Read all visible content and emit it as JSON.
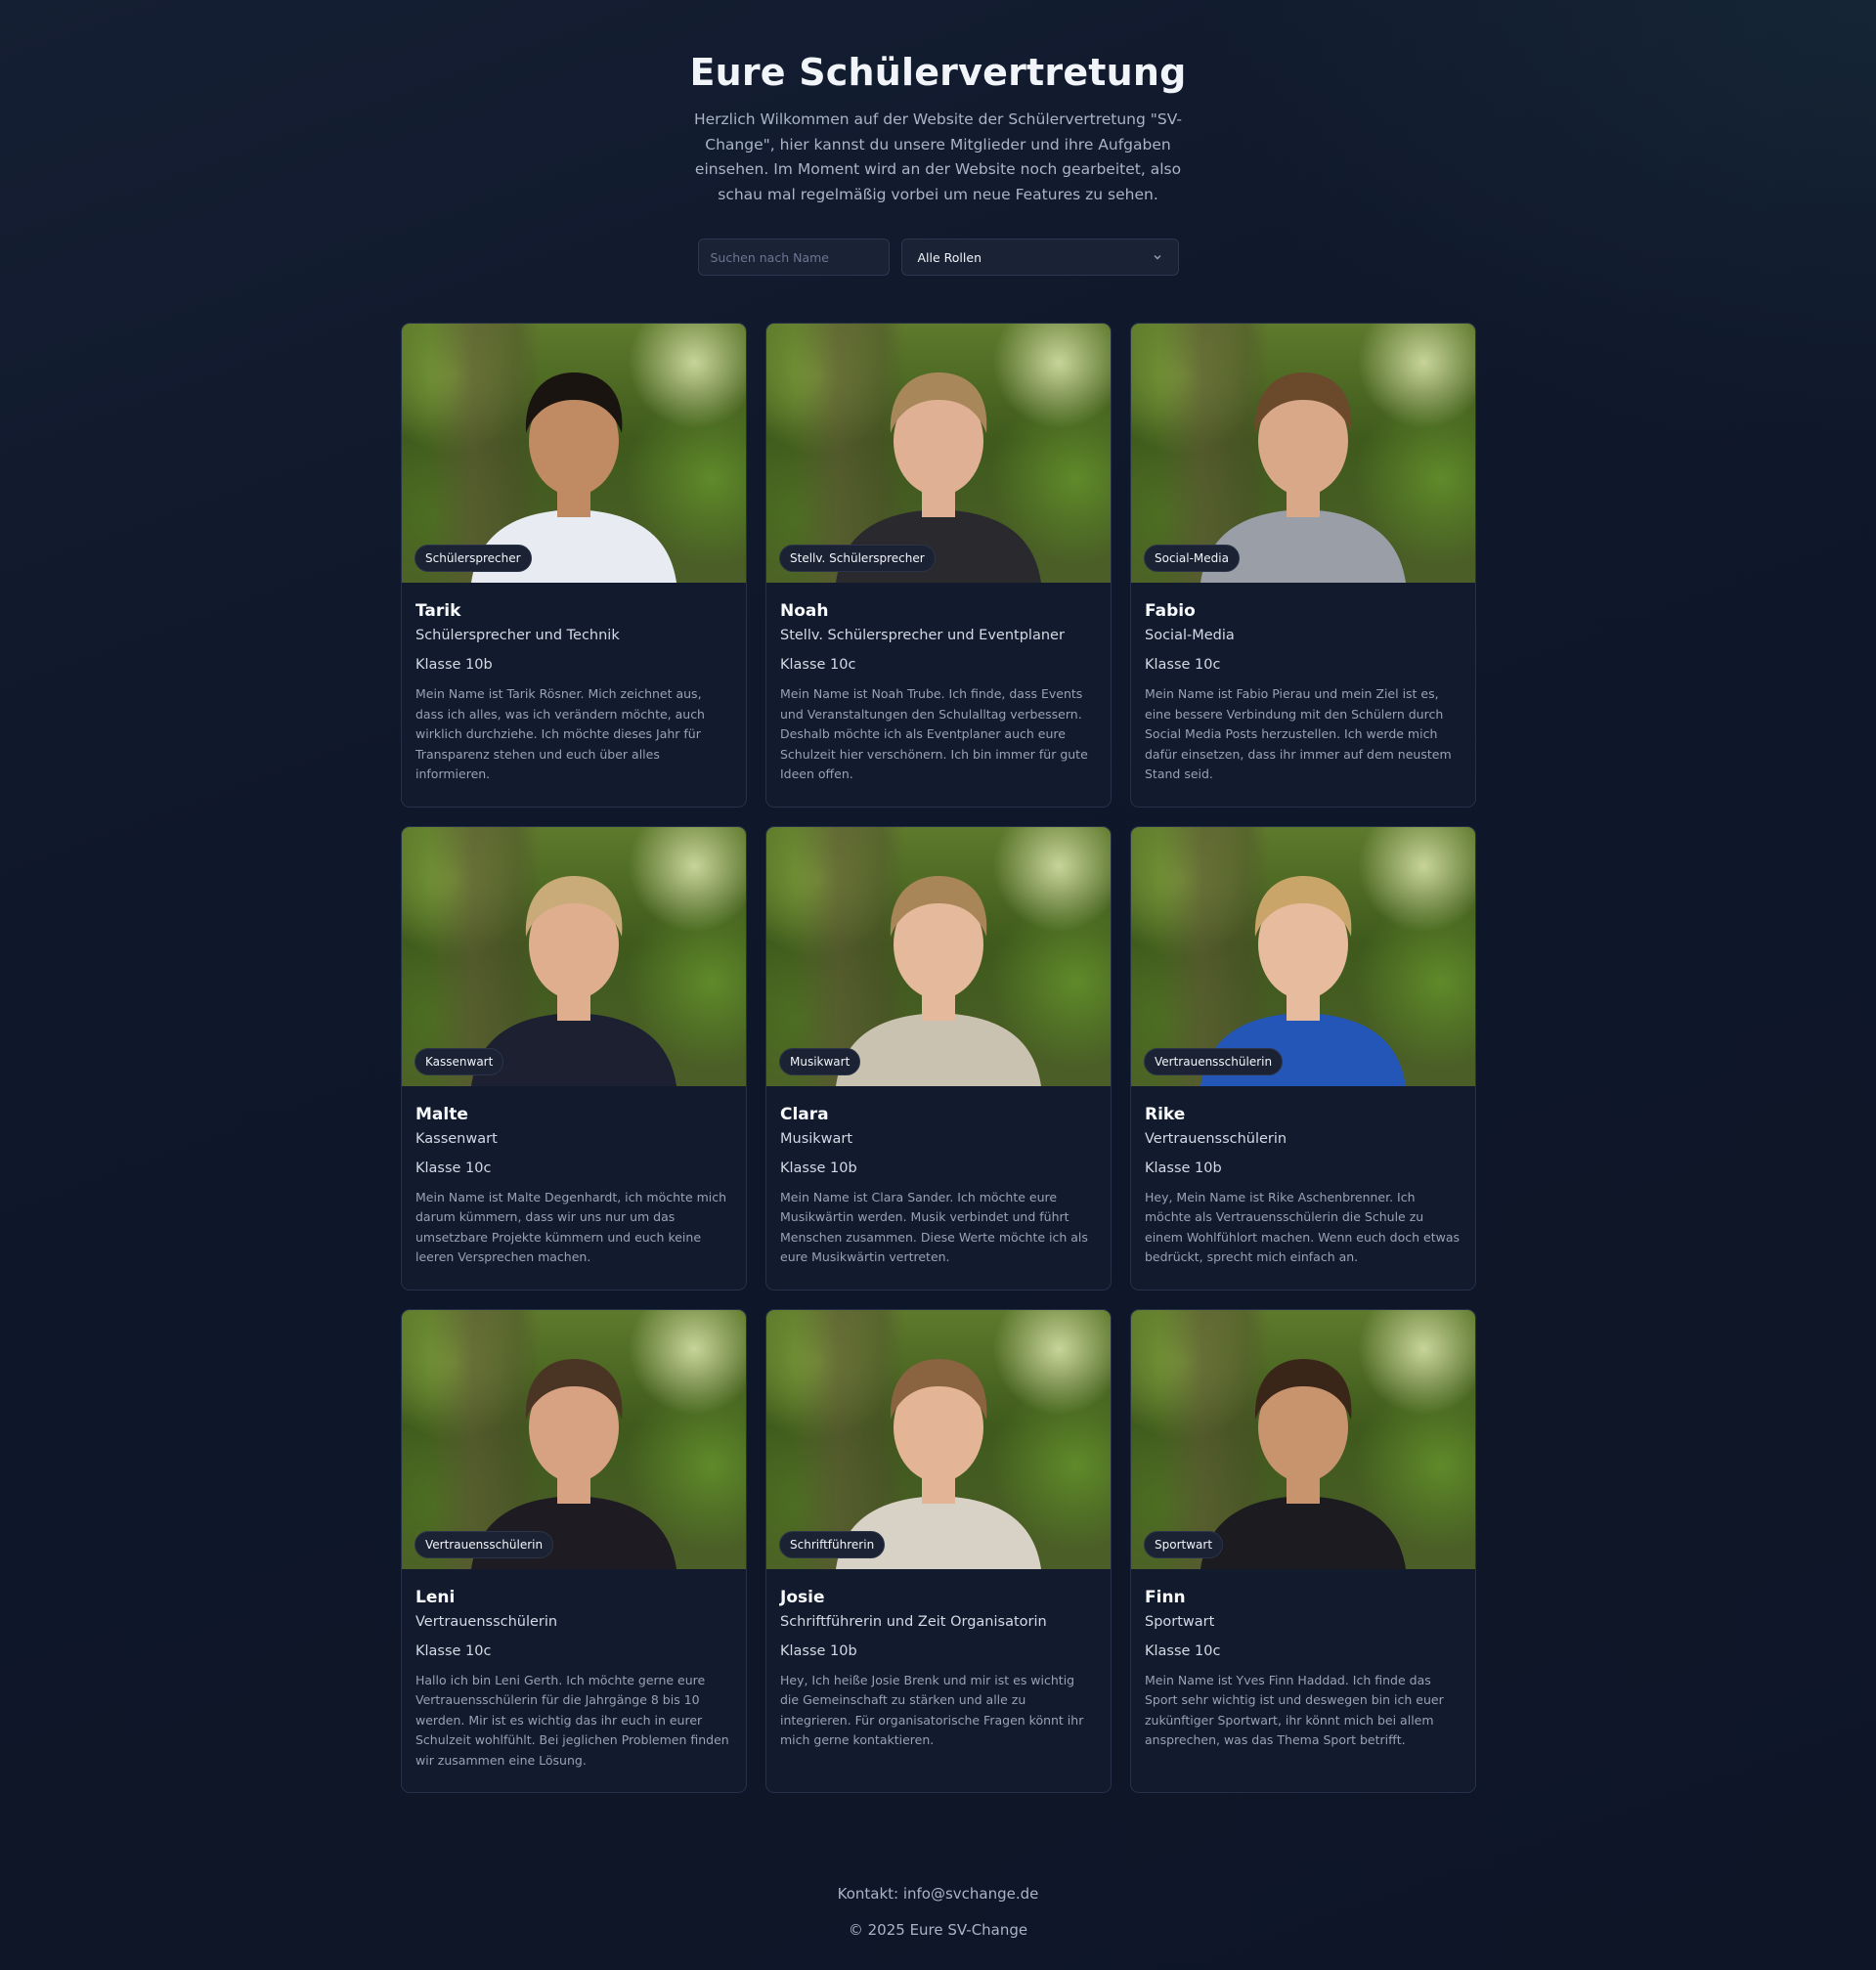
{
  "header": {
    "title": "Eure Schülervertretung",
    "intro": "Herzlich Wilkommen auf der Website der Schülervertretung \"SV-Change\", hier kannst du unsere Mitglieder und ihre Aufgaben einsehen. Im Moment wird an der Website noch gearbeitet, also schau mal regelmäßig vorbei um neue Features zu sehen."
  },
  "filters": {
    "search_placeholder": "Suchen nach Name",
    "search_value": "",
    "role_selected": "Alle Rollen"
  },
  "members": [
    {
      "badge": "Schülersprecher",
      "name": "Tarik",
      "role": "Schülersprecher und Technik",
      "klasse": "Klasse 10b",
      "bio": "Mein Name ist Tarik Rösner. Mich zeichnet aus, dass ich alles, was ich verändern möchte, auch wirklich durchziehe. Ich möchte dieses Jahr für Transparenz stehen und euch über alles informieren.",
      "hair": "#1a1410",
      "shirt": "#e8ecf2",
      "skin": "#c08a62"
    },
    {
      "badge": "Stellv. Schülersprecher",
      "name": "Noah",
      "role": "Stellv. Schülersprecher und Eventplaner",
      "klasse": "Klasse 10c",
      "bio": "Mein Name ist Noah Trube. Ich finde, dass Events und Veranstaltungen den Schulalltag verbessern. Deshalb möchte ich als Eventplaner auch eure Schulzeit hier verschönern. Ich bin immer für gute Ideen offen.",
      "hair": "#a8875a",
      "shirt": "#2a2a2e",
      "skin": "#e0b094"
    },
    {
      "badge": "Social-Media",
      "name": "Fabio",
      "role": "Social-Media",
      "klasse": "Klasse 10c",
      "bio": "Mein Name ist Fabio Pierau und mein Ziel ist es, eine bessere Verbindung mit den Schülern durch Social Media Posts herzustellen. Ich werde mich dafür einsetzen, dass ihr immer auf dem neustem Stand seid.",
      "hair": "#6b4a2c",
      "shirt": "#9a9ea6",
      "skin": "#d8a888"
    },
    {
      "badge": "Kassenwart",
      "name": "Malte",
      "role": "Kassenwart",
      "klasse": "Klasse 10c",
      "bio": "Mein Name ist Malte Degenhardt, ich möchte mich darum kümmern, dass wir uns nur um das umsetzbare Projekte kümmern und euch keine leeren Versprechen machen.",
      "hair": "#c8ab78",
      "shirt": "#1c2030",
      "skin": "#dfae8e"
    },
    {
      "badge": "Musikwart",
      "name": "Clara",
      "role": "Musikwart",
      "klasse": "Klasse 10b",
      "bio": "Mein Name ist Clara Sander. Ich möchte eure Musikwärtin werden. Musik verbindet und führt Menschen zusammen. Diese Werte möchte ich als eure Musikwärtin vertreten.",
      "hair": "#a98658",
      "shirt": "#c9c2b0",
      "skin": "#e4b99c"
    },
    {
      "badge": "Vertrauensschülerin",
      "name": "Rike",
      "role": "Vertrauensschülerin",
      "klasse": "Klasse 10b",
      "bio": "Hey, Mein Name ist Rike Aschenbrenner. Ich möchte als Vertrauensschülerin die Schule zu einem Wohlfühlort machen. Wenn euch doch etwas bedrückt, sprecht mich einfach an.",
      "hair": "#c9a56a",
      "shirt": "#2456b8",
      "skin": "#e7bb9e"
    },
    {
      "badge": "Vertrauensschülerin",
      "name": "Leni",
      "role": "Vertrauensschülerin",
      "klasse": "Klasse 10c",
      "bio": "Hallo ich bin Leni Gerth. Ich möchte gerne eure Vertrauensschülerin für die Jahrgänge 8 bis 10 werden. Mir ist es wichtig das ihr euch in eurer Schulzeit wohlfühlt. Bei jeglichen Problemen finden wir zusammen eine Lösung.",
      "hair": "#4a3424",
      "shirt": "#1e1c22",
      "skin": "#d7a282"
    },
    {
      "badge": "Schriftführerin",
      "name": "Josie",
      "role": "Schriftführerin und Zeit Organisatorin",
      "klasse": "Klasse 10b",
      "bio": "Hey, Ich heiße Josie Brenk und mir ist es wichtig die Gemeinschaft zu stärken und alle zu integrieren. Für organisatorische Fragen könnt ihr mich gerne kontaktieren.",
      "hair": "#8a6440",
      "shirt": "#d8d2c6",
      "skin": "#e3b496"
    },
    {
      "badge": "Sportwart",
      "name": "Finn",
      "role": "Sportwart",
      "klasse": "Klasse 10c",
      "bio": "Mein Name ist Yves Finn Haddad. Ich finde das Sport sehr wichtig ist und deswegen bin ich euer zukünftiger Sportwart, ihr könnt mich bei allem ansprechen, was das Thema Sport betrifft.",
      "hair": "#3a2618",
      "shirt": "#1c1c20",
      "skin": "#c8946e"
    }
  ],
  "footer": {
    "contact": "Kontakt: info@svchange.de",
    "copyright": "© 2025 Eure SV-Change"
  }
}
